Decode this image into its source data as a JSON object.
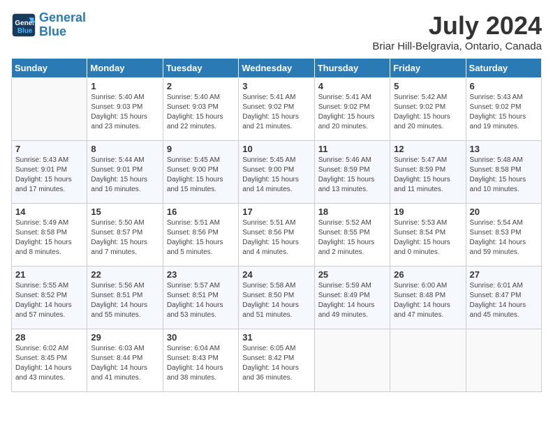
{
  "header": {
    "logo": {
      "line1": "General",
      "line2": "Blue"
    },
    "title": "July 2024",
    "location": "Briar Hill-Belgravia, Ontario, Canada"
  },
  "days_of_week": [
    "Sunday",
    "Monday",
    "Tuesday",
    "Wednesday",
    "Thursday",
    "Friday",
    "Saturday"
  ],
  "weeks": [
    [
      {
        "day": "",
        "content": ""
      },
      {
        "day": "1",
        "content": "Sunrise: 5:40 AM\nSunset: 9:03 PM\nDaylight: 15 hours\nand 23 minutes."
      },
      {
        "day": "2",
        "content": "Sunrise: 5:40 AM\nSunset: 9:03 PM\nDaylight: 15 hours\nand 22 minutes."
      },
      {
        "day": "3",
        "content": "Sunrise: 5:41 AM\nSunset: 9:02 PM\nDaylight: 15 hours\nand 21 minutes."
      },
      {
        "day": "4",
        "content": "Sunrise: 5:41 AM\nSunset: 9:02 PM\nDaylight: 15 hours\nand 20 minutes."
      },
      {
        "day": "5",
        "content": "Sunrise: 5:42 AM\nSunset: 9:02 PM\nDaylight: 15 hours\nand 20 minutes."
      },
      {
        "day": "6",
        "content": "Sunrise: 5:43 AM\nSunset: 9:02 PM\nDaylight: 15 hours\nand 19 minutes."
      }
    ],
    [
      {
        "day": "7",
        "content": "Sunrise: 5:43 AM\nSunset: 9:01 PM\nDaylight: 15 hours\nand 17 minutes."
      },
      {
        "day": "8",
        "content": "Sunrise: 5:44 AM\nSunset: 9:01 PM\nDaylight: 15 hours\nand 16 minutes."
      },
      {
        "day": "9",
        "content": "Sunrise: 5:45 AM\nSunset: 9:00 PM\nDaylight: 15 hours\nand 15 minutes."
      },
      {
        "day": "10",
        "content": "Sunrise: 5:45 AM\nSunset: 9:00 PM\nDaylight: 15 hours\nand 14 minutes."
      },
      {
        "day": "11",
        "content": "Sunrise: 5:46 AM\nSunset: 8:59 PM\nDaylight: 15 hours\nand 13 minutes."
      },
      {
        "day": "12",
        "content": "Sunrise: 5:47 AM\nSunset: 8:59 PM\nDaylight: 15 hours\nand 11 minutes."
      },
      {
        "day": "13",
        "content": "Sunrise: 5:48 AM\nSunset: 8:58 PM\nDaylight: 15 hours\nand 10 minutes."
      }
    ],
    [
      {
        "day": "14",
        "content": "Sunrise: 5:49 AM\nSunset: 8:58 PM\nDaylight: 15 hours\nand 8 minutes."
      },
      {
        "day": "15",
        "content": "Sunrise: 5:50 AM\nSunset: 8:57 PM\nDaylight: 15 hours\nand 7 minutes."
      },
      {
        "day": "16",
        "content": "Sunrise: 5:51 AM\nSunset: 8:56 PM\nDaylight: 15 hours\nand 5 minutes."
      },
      {
        "day": "17",
        "content": "Sunrise: 5:51 AM\nSunset: 8:56 PM\nDaylight: 15 hours\nand 4 minutes."
      },
      {
        "day": "18",
        "content": "Sunrise: 5:52 AM\nSunset: 8:55 PM\nDaylight: 15 hours\nand 2 minutes."
      },
      {
        "day": "19",
        "content": "Sunrise: 5:53 AM\nSunset: 8:54 PM\nDaylight: 15 hours\nand 0 minutes."
      },
      {
        "day": "20",
        "content": "Sunrise: 5:54 AM\nSunset: 8:53 PM\nDaylight: 14 hours\nand 59 minutes."
      }
    ],
    [
      {
        "day": "21",
        "content": "Sunrise: 5:55 AM\nSunset: 8:52 PM\nDaylight: 14 hours\nand 57 minutes."
      },
      {
        "day": "22",
        "content": "Sunrise: 5:56 AM\nSunset: 8:51 PM\nDaylight: 14 hours\nand 55 minutes."
      },
      {
        "day": "23",
        "content": "Sunrise: 5:57 AM\nSunset: 8:51 PM\nDaylight: 14 hours\nand 53 minutes."
      },
      {
        "day": "24",
        "content": "Sunrise: 5:58 AM\nSunset: 8:50 PM\nDaylight: 14 hours\nand 51 minutes."
      },
      {
        "day": "25",
        "content": "Sunrise: 5:59 AM\nSunset: 8:49 PM\nDaylight: 14 hours\nand 49 minutes."
      },
      {
        "day": "26",
        "content": "Sunrise: 6:00 AM\nSunset: 8:48 PM\nDaylight: 14 hours\nand 47 minutes."
      },
      {
        "day": "27",
        "content": "Sunrise: 6:01 AM\nSunset: 8:47 PM\nDaylight: 14 hours\nand 45 minutes."
      }
    ],
    [
      {
        "day": "28",
        "content": "Sunrise: 6:02 AM\nSunset: 8:45 PM\nDaylight: 14 hours\nand 43 minutes."
      },
      {
        "day": "29",
        "content": "Sunrise: 6:03 AM\nSunset: 8:44 PM\nDaylight: 14 hours\nand 41 minutes."
      },
      {
        "day": "30",
        "content": "Sunrise: 6:04 AM\nSunset: 8:43 PM\nDaylight: 14 hours\nand 38 minutes."
      },
      {
        "day": "31",
        "content": "Sunrise: 6:05 AM\nSunset: 8:42 PM\nDaylight: 14 hours\nand 36 minutes."
      },
      {
        "day": "",
        "content": ""
      },
      {
        "day": "",
        "content": ""
      },
      {
        "day": "",
        "content": ""
      }
    ]
  ]
}
